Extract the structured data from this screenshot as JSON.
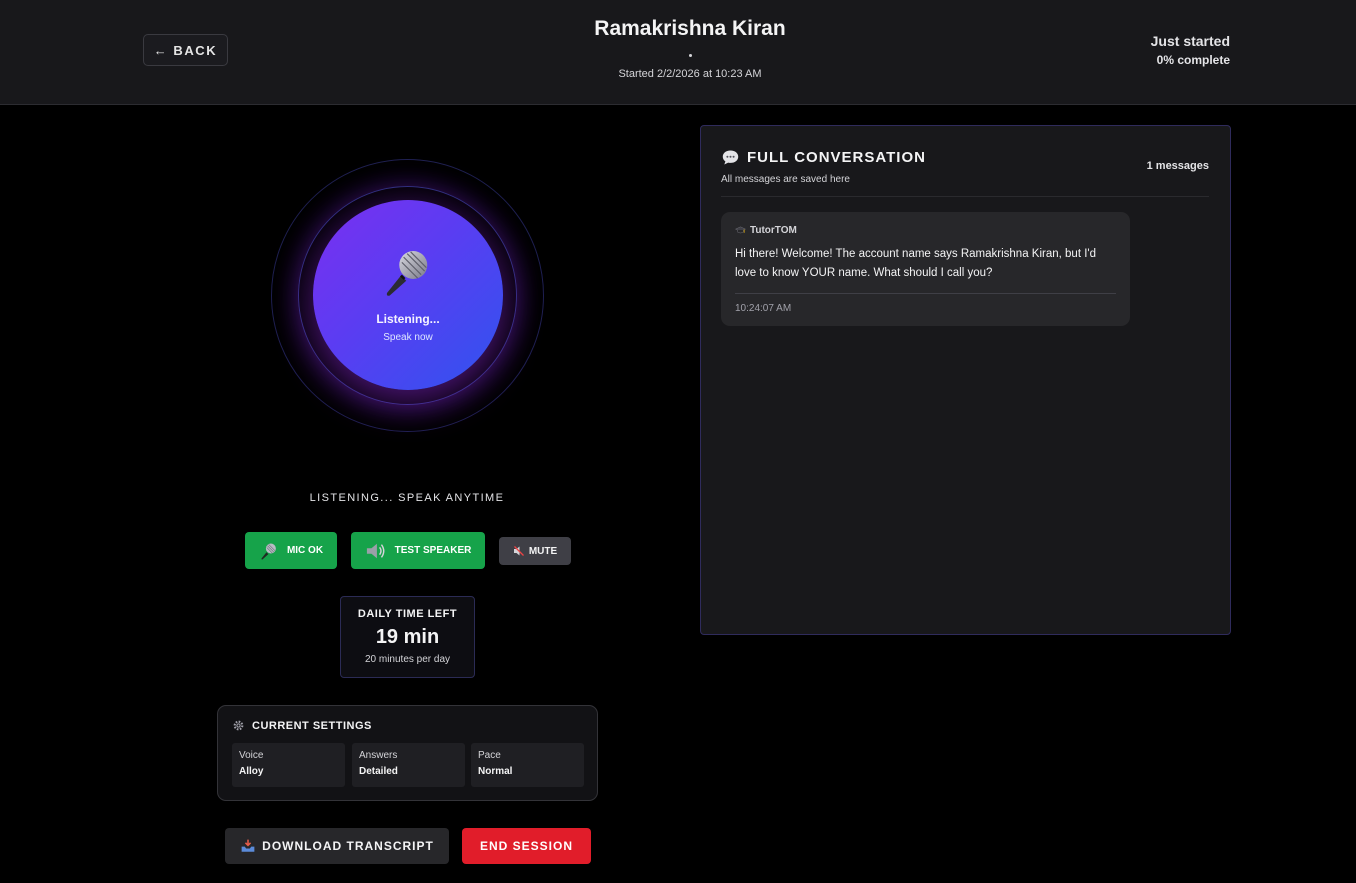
{
  "header": {
    "back_label": "BACK",
    "back_arrow": "←",
    "session_name": "Ramakrishna Kiran",
    "started": "Started 2/2/2026 at 10:23 AM",
    "progress_status": "Just started",
    "progress_percent": "0% complete"
  },
  "orb": {
    "status": "Listening...",
    "hint": "Speak now",
    "icon": "microphone-icon"
  },
  "listen_status": "LISTENING... SPEAK ANYTIME",
  "controls": {
    "mic_label": "MIC OK",
    "speaker_label": "TEST SPEAKER",
    "mute_label": "MUTE"
  },
  "daily_time": {
    "label": "DAILY TIME LEFT",
    "value": "19 min",
    "sub": "20 minutes per day"
  },
  "settings": {
    "title": "CURRENT SETTINGS",
    "items": [
      {
        "key": "Voice",
        "value": "Alloy"
      },
      {
        "key": "Answers",
        "value": "Detailed"
      },
      {
        "key": "Pace",
        "value": "Normal"
      }
    ]
  },
  "actions": {
    "download_label": "DOWNLOAD TRANSCRIPT",
    "end_label": "END SESSION"
  },
  "conversation": {
    "title": "FULL CONVERSATION",
    "subtitle": "All messages are saved here",
    "count": "1 messages",
    "messages": [
      {
        "sender": "TutorTOM",
        "text": "Hi there! Welcome! The account name says Ramakrishna Kiran, but I'd love to know YOUR name. What should I call you?",
        "time": "10:24:07 AM"
      }
    ]
  },
  "colors": {
    "accent_green": "#16a34a",
    "danger_red": "#e11d2a",
    "orb_start": "#7b2ff0",
    "orb_end": "#2f54ef"
  }
}
